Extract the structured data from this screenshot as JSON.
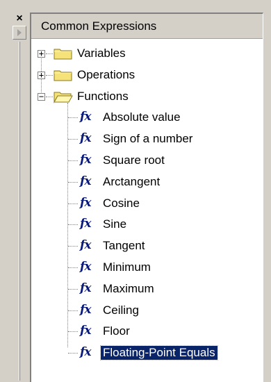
{
  "left_controls": {
    "close_label": "×"
  },
  "panel": {
    "title": "Common Expressions"
  },
  "tree": {
    "folders": [
      {
        "label": "Variables",
        "expanded": false,
        "expander": "+"
      },
      {
        "label": "Operations",
        "expanded": false,
        "expander": "+"
      },
      {
        "label": "Functions",
        "expanded": true,
        "expander": "−"
      }
    ],
    "function_icon": "fx",
    "functions": [
      "Absolute value",
      "Sign of a number",
      "Square root",
      "Arctangent",
      "Cosine",
      "Sine",
      "Tangent",
      "Minimum",
      "Maximum",
      "Ceiling",
      "Floor",
      "Floating-Point Equals"
    ],
    "selected": "Floating-Point Equals"
  },
  "colors": {
    "selection_bg": "#0a246a",
    "fx_icon": "#0a1a7a",
    "folder": "#f5e37a"
  }
}
